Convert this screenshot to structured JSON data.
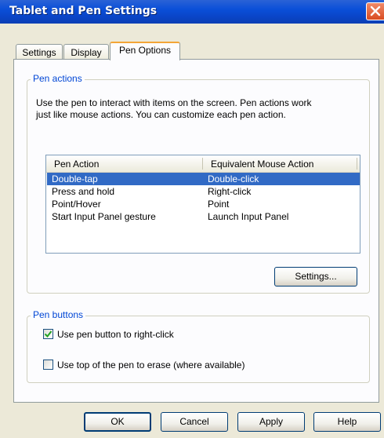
{
  "window": {
    "title": "Tablet and Pen Settings"
  },
  "tabs": [
    {
      "label": "Settings"
    },
    {
      "label": "Display"
    },
    {
      "label": "Pen Options"
    }
  ],
  "pen_actions": {
    "group_label": "Pen actions",
    "description_line1": "Use the pen to interact with items on the screen. Pen actions work",
    "description_line2": "just like mouse actions. You can customize each pen action.",
    "columns": [
      "Pen Action",
      "Equivalent Mouse Action"
    ],
    "rows": [
      {
        "action": "Double-tap",
        "mouse": "Double-click"
      },
      {
        "action": "Press and hold",
        "mouse": "Right-click"
      },
      {
        "action": "Point/Hover",
        "mouse": "Point"
      },
      {
        "action": "Start Input Panel gesture",
        "mouse": "Launch Input Panel"
      }
    ],
    "selected_row": 0,
    "settings_button": "Settings..."
  },
  "pen_buttons": {
    "group_label": "Pen buttons",
    "options": [
      {
        "label": "Use pen button to right-click",
        "checked": true
      },
      {
        "label": "Use top of the pen to erase (where available)",
        "checked": false
      }
    ]
  },
  "footer": {
    "ok": "OK",
    "cancel": "Cancel",
    "apply": "Apply",
    "help": "Help"
  },
  "colors": {
    "titlebar": "#0a4fd8",
    "selection": "#316ac5",
    "group_title": "#0046d5",
    "close_button": "#d94c21",
    "selected_tab_accent": "#f3a537"
  }
}
